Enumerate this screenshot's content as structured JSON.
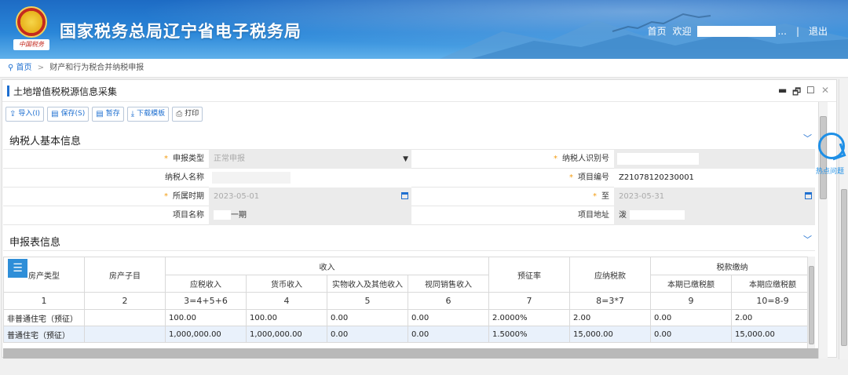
{
  "header": {
    "emblem_text": "中国税务",
    "title": "国家税务总局辽宁省电子税务局",
    "nav_home": "首页",
    "nav_welcome": "欢迎",
    "nav_ellipsis": "...",
    "nav_sep": "|",
    "nav_logout": "退出"
  },
  "breadcrumb": {
    "home": "首页",
    "separator": ">",
    "current": "财产和行为税合并纳税申报"
  },
  "panel": {
    "title": "土地增值税税源信息采集",
    "controls": [
      "▬",
      "🗗",
      "☐",
      "✕"
    ]
  },
  "toolbar": [
    {
      "icon": "import-icon",
      "glyph": "⇪",
      "label": "导入(I)"
    },
    {
      "icon": "save-icon",
      "glyph": "▤",
      "label": "保存(S)"
    },
    {
      "icon": "draft-icon",
      "glyph": "▤",
      "label": "暂存"
    },
    {
      "icon": "download-icon",
      "glyph": "⤓",
      "label": "下载模板"
    },
    {
      "icon": "print-icon",
      "glyph": "⎙",
      "label": "打印"
    }
  ],
  "basic": {
    "section_title": "纳税人基本信息",
    "report_type_label": "申报类型",
    "report_type_value": "正常申报",
    "taxpayer_id_label": "纳税人识别号",
    "taxpayer_name_label": "纳税人名称",
    "project_no_label": "项目编号",
    "project_no_value": "Z21078120230001",
    "period_label": "所属时期",
    "period_from": "2023-05-01",
    "period_to_label": "至",
    "period_to": "2023-05-31",
    "project_name_label": "项目名称",
    "project_name_value": "一期",
    "project_addr_label": "项目地址",
    "project_addr_value": "泼"
  },
  "report": {
    "section_title": "申报表信息",
    "h_property_type": "房产类型",
    "h_property_sub": "房产子目",
    "h_income": "收入",
    "h_prelevy_rate": "预征率",
    "h_tax_payable": "应纳税款",
    "h_tax_payment": "税款缴纳",
    "h_taxable_income": "应税收入",
    "h_cash_income": "货币收入",
    "h_inkind_income": "实物收入及其他收入",
    "h_deemed_sales": "视同销售收入",
    "h_paid": "本期已缴税额",
    "h_due": "本期应缴税额",
    "col_numbers": [
      "1",
      "2",
      "3=4+5+6",
      "4",
      "5",
      "6",
      "7",
      "8=3*7",
      "9",
      "10=8-9"
    ],
    "rows": [
      [
        "非普通住宅（预征）",
        "",
        "100.00",
        "100.00",
        "0.00",
        "0.00",
        "2.0000%",
        "2.00",
        "0.00",
        "2.00"
      ],
      [
        "普通住宅（预征）",
        "",
        "1,000,000.00",
        "1,000,000.00",
        "0.00",
        "0.00",
        "1.5000%",
        "15,000.00",
        "0.00",
        "15,000.00"
      ]
    ]
  },
  "hot_issue": "热点问题"
}
